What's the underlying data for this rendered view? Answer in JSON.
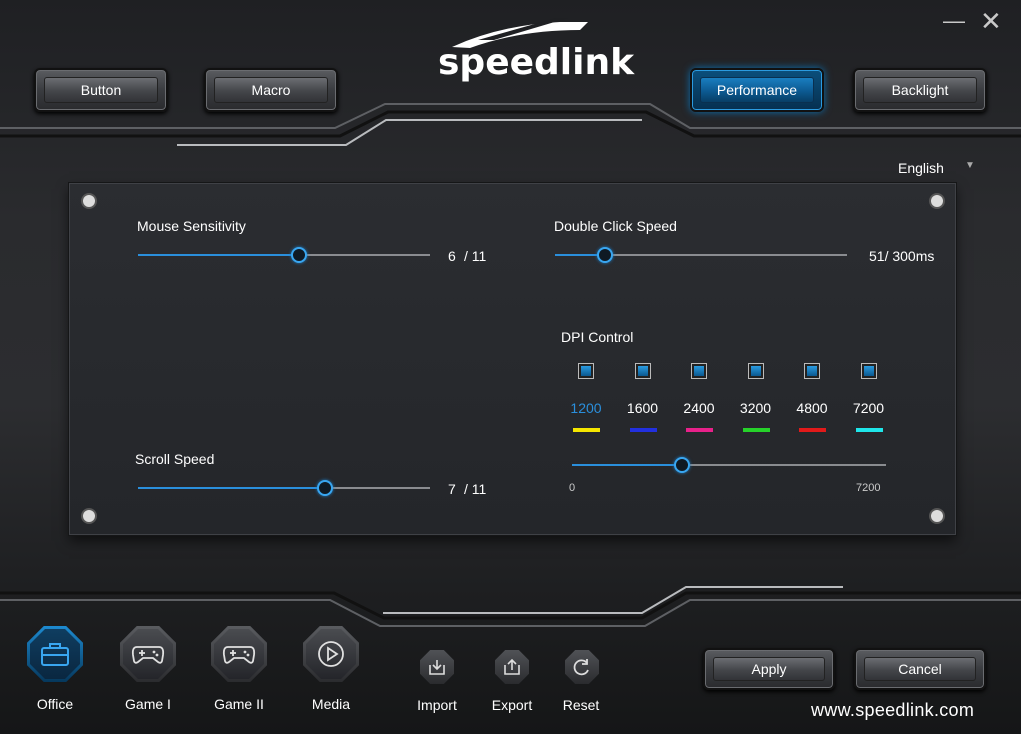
{
  "window": {
    "minimize_glyph": "—",
    "close_glyph": "✕"
  },
  "brand": {
    "logo_text": "speedlink",
    "url": "www.speedlink.com"
  },
  "top_tabs": [
    {
      "label": "Button",
      "active": false
    },
    {
      "label": "Macro",
      "active": false
    },
    {
      "label": "Performance",
      "active": true
    },
    {
      "label": "Backlight",
      "active": false
    }
  ],
  "language": {
    "selected": "English",
    "arrow": "▼"
  },
  "performance": {
    "mouse_sensitivity": {
      "label": "Mouse Sensitivity",
      "value": "6",
      "max": "/ 11",
      "level": 0.55
    },
    "double_click_speed": {
      "label": "Double Click Speed",
      "value": "51/ 300ms",
      "level": 0.17
    },
    "scroll_speed": {
      "label": "Scroll Speed",
      "value": "7",
      "max": "/ 11",
      "level": 0.64
    },
    "dpi_control": {
      "label": "DPI Control",
      "levels": [
        {
          "value": "1200",
          "color": "#f5e600",
          "checked": true,
          "selected": true
        },
        {
          "value": "1600",
          "color": "#2230e0",
          "checked": true,
          "selected": false
        },
        {
          "value": "2400",
          "color": "#e8218a",
          "checked": true,
          "selected": false
        },
        {
          "value": "3200",
          "color": "#26d22a",
          "checked": true,
          "selected": false
        },
        {
          "value": "4800",
          "color": "#e21a1a",
          "checked": true,
          "selected": false
        },
        {
          "value": "7200",
          "color": "#1fe6ea",
          "checked": true,
          "selected": false
        }
      ],
      "slider_min": "0",
      "slider_max": "7200",
      "slider_level": 0.35
    }
  },
  "modes": [
    {
      "label": "Office",
      "icon": "briefcase-icon",
      "active": true
    },
    {
      "label": "Game I",
      "icon": "gamepad-icon",
      "active": false
    },
    {
      "label": "Game II",
      "icon": "gamepad-icon",
      "active": false
    },
    {
      "label": "Media",
      "icon": "play-icon",
      "active": false
    }
  ],
  "tools": [
    {
      "label": "Import",
      "icon": "import-icon"
    },
    {
      "label": "Export",
      "icon": "export-icon"
    },
    {
      "label": "Reset",
      "icon": "reset-icon"
    }
  ],
  "actions": {
    "apply": "Apply",
    "cancel": "Cancel"
  },
  "colors": {
    "accent": "#2a8fdc",
    "active_tab": "#0c5a92"
  }
}
